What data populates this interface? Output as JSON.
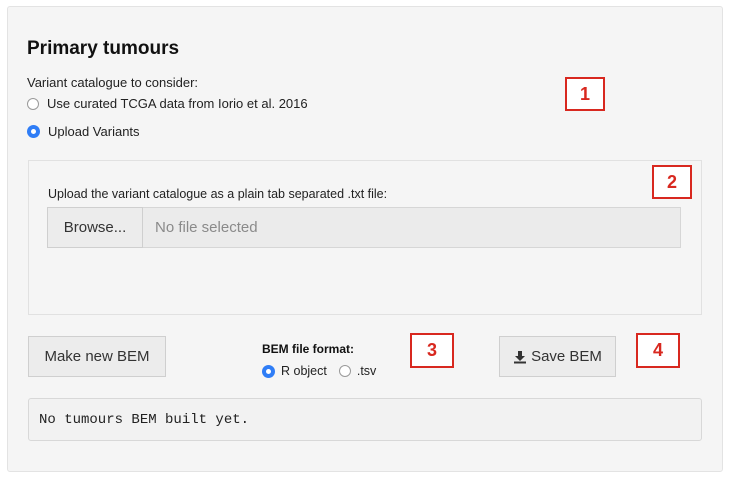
{
  "panel": {
    "title": "Primary tumours",
    "catalogue_label": "Variant catalogue to consider:",
    "options": [
      {
        "label": "Use curated TCGA data from Iorio et al. 2016",
        "checked": false
      },
      {
        "label": "Upload Variants",
        "checked": true
      }
    ]
  },
  "upload": {
    "label": "Upload the variant catalogue as a plain tab separated .txt file:",
    "browse_label": "Browse...",
    "file_placeholder": "No file selected"
  },
  "actions": {
    "make_label": "Make new BEM",
    "format_label": "BEM file format:",
    "formats": [
      {
        "label": "R object",
        "checked": true
      },
      {
        "label": ".tsv",
        "checked": false
      }
    ],
    "save_label": "Save BEM",
    "save_icon": "download-icon"
  },
  "output": {
    "text": "No tumours BEM built yet."
  },
  "markers": [
    "1",
    "2",
    "3",
    "4"
  ],
  "colors": {
    "accent": "#2f7df6",
    "marker": "#d8281f"
  }
}
